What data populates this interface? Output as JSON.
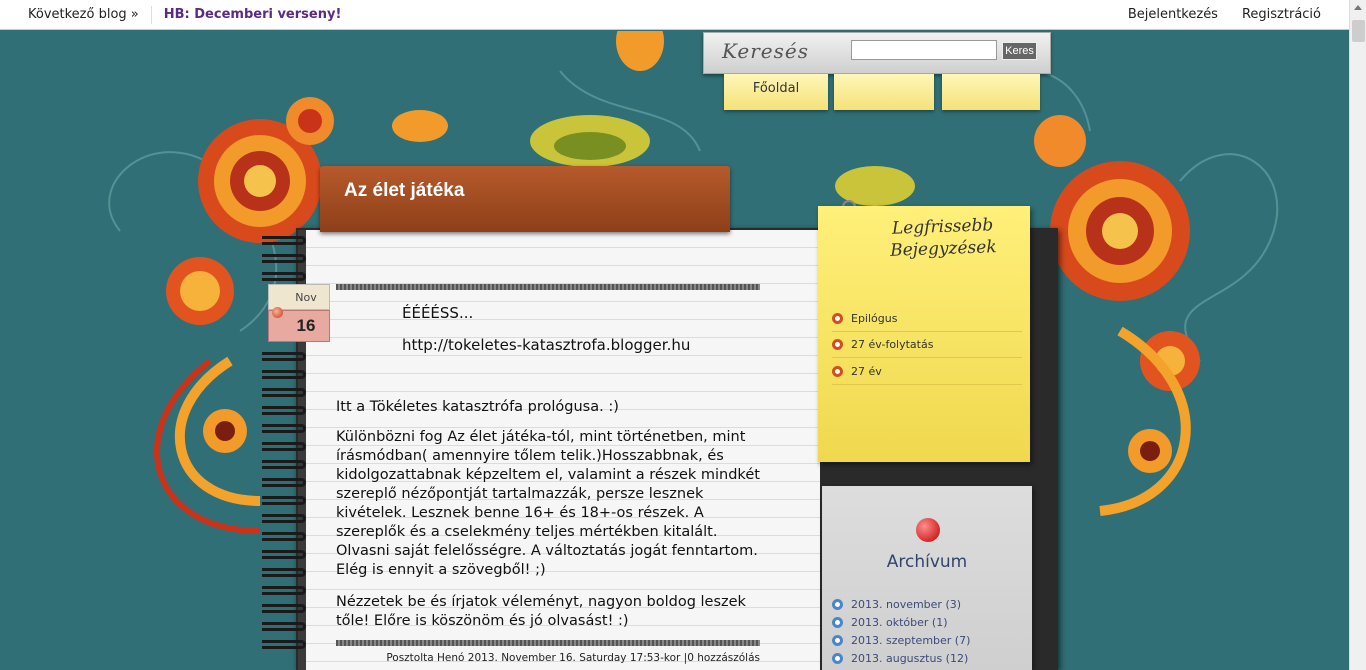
{
  "topbar": {
    "next_blog": "Következő blog »",
    "promo": "HB: Decemberi verseny!",
    "login": "Bejelentkezés",
    "register": "Regisztráció"
  },
  "search": {
    "label": "Keresés",
    "button": "Keres",
    "value": ""
  },
  "nav": {
    "tabs": [
      "Főoldal",
      "",
      ""
    ]
  },
  "blog": {
    "title": "Az élet játéka"
  },
  "post": {
    "month": "Nov",
    "day": "16",
    "title": "ÉÉÉÉSS...",
    "link": "http://tokeletes-katasztrofa.blogger.hu",
    "p1": "Itt a Tökéletes katasztrófa prológusa. :)",
    "p2": "Különbözni fog Az élet játéka-tól, mint történetben, mint írásmódban( amennyire tőlem telik.)Hosszabbnak, és kidolgozattabnak képzeltem el, valamint a részek mindkét szereplő nézőpontját tartalmazzák, persze lesznek kivételek. Lesznek benne 16+ és 18+-os részek. A szereplők és a cselekmény teljes mértékben kitalált. Olvasni saját felelősségre. A változtatás jogát fenntartom. Elég is ennyit a szövegből! ;)",
    "p3": "Nézzetek be és írjatok véleményt, nagyon boldog leszek tőle! Előre is köszönöm és jó olvasást! :)",
    "footer": "Posztolta Henó 2013. November 16. Saturday 17:53-kor  |0 hozzászólás"
  },
  "recent": {
    "heading": "Legfrissebb Bejegyzések",
    "items": [
      "Epilógus",
      "27 év-folytatás",
      "27 év"
    ]
  },
  "archive": {
    "heading": "Archívum",
    "items": [
      "2013. november (3)",
      "2013. október (1)",
      "2013. szeptember (7)",
      "2013. augusztus (12)"
    ]
  },
  "colors": {
    "background": "#2f6f75",
    "title_banner": "#a14a20",
    "promo": "#5b2a86",
    "bullet_recent": "#d0501f",
    "bullet_archive": "#4a86c8"
  }
}
